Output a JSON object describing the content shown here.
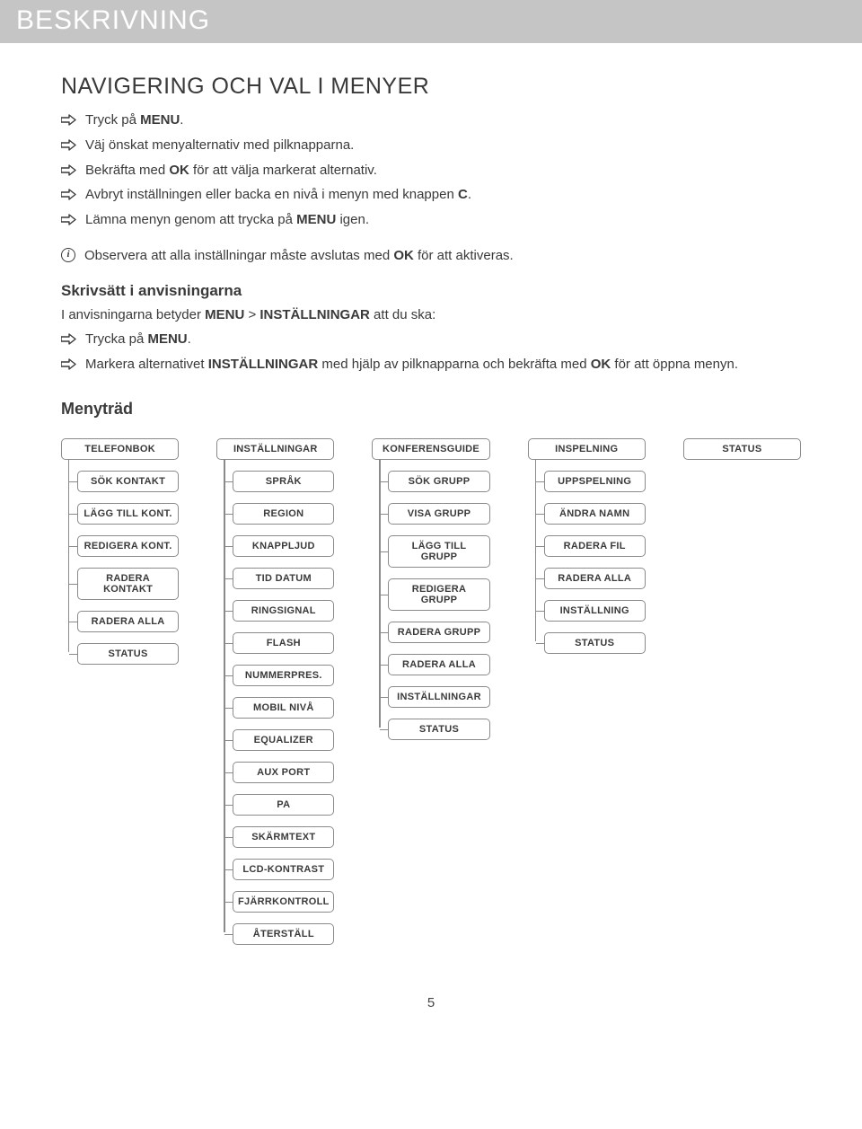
{
  "header": "BESKRIVNING",
  "section_heading": "NAVIGERING OCH VAL I MENYER",
  "nav_bullets": [
    {
      "pre": "Tryck på ",
      "bold": "MENU",
      "post": "."
    },
    {
      "pre": "Väj önskat menyalternativ med pilknapparna.",
      "bold": "",
      "post": ""
    },
    {
      "pre": "Bekräfta med ",
      "bold": "OK",
      "post": " för att välja markerat alternativ."
    },
    {
      "pre": "Avbryt inställningen eller backa en nivå i menyn med knappen ",
      "bold": "C",
      "post": "."
    },
    {
      "pre": "Lämna menyn genom att trycka på ",
      "bold": "MENU",
      "post": " igen."
    }
  ],
  "info_line": {
    "pre": "Observera att alla inställningar måste avslutas med ",
    "bold": "OK",
    "post": " för att aktiveras."
  },
  "sub_heading": "Skrivsätt i anvisningarna",
  "sub_line_text": {
    "pre": "I anvisningarna betyder ",
    "b1": "MENU",
    "mid": " > ",
    "b2": "INSTÄLLNINGAR",
    "post": " att du ska:"
  },
  "sub_bullets": [
    {
      "pre": "Trycka på ",
      "bold": "MENU",
      "post": "."
    },
    {
      "pre": "Markera alternativet ",
      "bold": "INSTÄLLNINGAR",
      "post": " med hjälp av pilknapparna och bekräfta med ",
      "bold2": "OK",
      "post2": " för att öppna menyn."
    }
  ],
  "tree_heading": "Menyträd",
  "tree": [
    {
      "top": "TELEFONBOK",
      "children": [
        "SÖK KONTAKT",
        "LÄGG TILL KONT.",
        "REDIGERA KONT.",
        "RADERA KONTAKT",
        "RADERA ALLA",
        "STATUS"
      ]
    },
    {
      "top": "INSTÄLLNINGAR",
      "children": [
        "SPRÅK",
        "REGION",
        "KNAPPLJUD",
        "TID DATUM",
        "RINGSIGNAL",
        "FLASH",
        "NUMMERPRES.",
        "MOBIL NIVÅ",
        "EQUALIZER",
        "AUX PORT",
        "PA",
        "SKÄRMTEXT",
        "LCD-KONTRAST",
        "FJÄRRKONTROLL",
        "ÅTERSTÄLL"
      ]
    },
    {
      "top": "KONFERENSGUIDE",
      "children": [
        "SÖK GRUPP",
        "VISA GRUPP",
        "LÄGG TILL GRUPP",
        "REDIGERA GRUPP",
        "RADERA GRUPP",
        "RADERA ALLA",
        "INSTÄLLNINGAR",
        "STATUS"
      ]
    },
    {
      "top": "INSPELNING",
      "children": [
        "UPPSPELNING",
        "ÄNDRA NAMN",
        "RADERA FIL",
        "RADERA ALLA",
        "INSTÄLLNING",
        "STATUS"
      ]
    },
    {
      "top": "STATUS",
      "children": []
    }
  ],
  "page_number": "5"
}
